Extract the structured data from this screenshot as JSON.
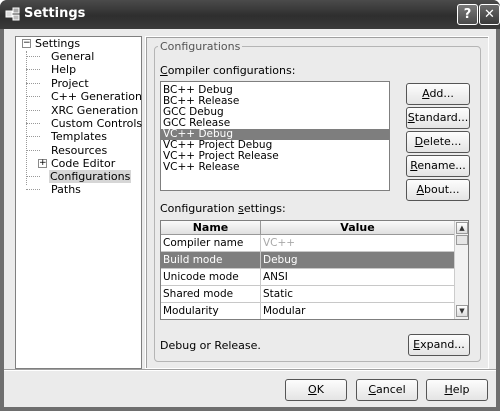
{
  "window": {
    "title": "Settings",
    "help_label": "?",
    "close_label": "✕"
  },
  "tree": {
    "items": [
      {
        "label": "Settings",
        "expander": "−"
      },
      {
        "label": "General"
      },
      {
        "label": "Help"
      },
      {
        "label": "Project"
      },
      {
        "label": "C++ Generation"
      },
      {
        "label": "XRC Generation"
      },
      {
        "label": "Custom Controls"
      },
      {
        "label": "Templates"
      },
      {
        "label": "Resources"
      },
      {
        "label": "Code Editor",
        "expander": "+"
      },
      {
        "label": "Configurations"
      },
      {
        "label": "Paths"
      }
    ]
  },
  "configurations": {
    "group_title": "Configurations",
    "compiler_label_u": "C",
    "compiler_label_rest": "ompiler configurations:",
    "compiler_list": [
      "BC++ Debug",
      "BC++ Release",
      "GCC Debug",
      "GCC Release",
      "VC++ Debug",
      "VC++ Project Debug",
      "VC++ Project Release",
      "VC++ Release"
    ],
    "selected_index": 4,
    "buttons": {
      "add": {
        "u": "A",
        "rest": "dd..."
      },
      "standard": {
        "u": "S",
        "rest": "tandard..."
      },
      "delete": {
        "u": "D",
        "rest": "elete..."
      },
      "rename": {
        "u": "R",
        "rest": "ename..."
      },
      "about": {
        "u": "A",
        "rest": "bout..."
      }
    },
    "settings_label_pre": "Configuration ",
    "settings_label_u": "s",
    "settings_label_post": "ettings:",
    "grid": {
      "columns": [
        "Name",
        "Value"
      ],
      "rows": [
        {
          "name": "Compiler name",
          "value": "VC++",
          "dim": true
        },
        {
          "name": "Build mode",
          "value": "Debug",
          "selected": true
        },
        {
          "name": "Unicode mode",
          "value": "ANSI"
        },
        {
          "name": "Shared mode",
          "value": "Static"
        },
        {
          "name": "Modularity",
          "value": "Modular"
        }
      ]
    },
    "description": "Debug or Release.",
    "expand_button": {
      "u": "E",
      "rest": "xpand..."
    }
  },
  "footer": {
    "ok": {
      "u": "O",
      "rest": "K"
    },
    "cancel": {
      "u": "C",
      "rest": "ancel"
    },
    "help": {
      "u": "H",
      "rest": "elp"
    }
  }
}
